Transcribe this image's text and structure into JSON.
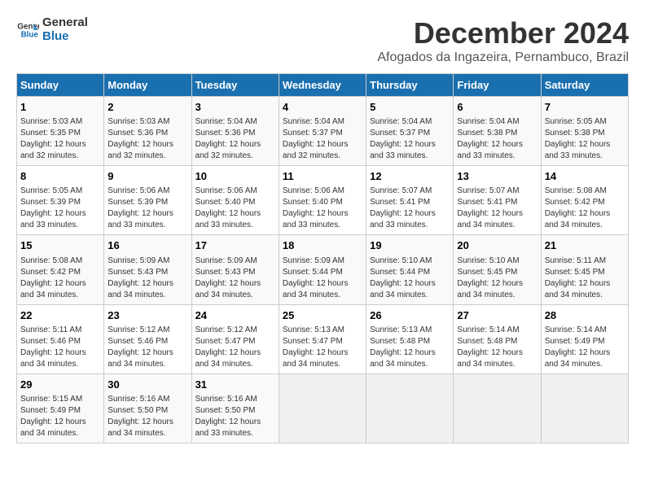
{
  "logo": {
    "line1": "General",
    "line2": "Blue"
  },
  "header": {
    "title": "December 2024",
    "subtitle": "Afogados da Ingazeira, Pernambuco, Brazil"
  },
  "days_of_week": [
    "Sunday",
    "Monday",
    "Tuesday",
    "Wednesday",
    "Thursday",
    "Friday",
    "Saturday"
  ],
  "weeks": [
    [
      {
        "day": "1",
        "info": "Sunrise: 5:03 AM\nSunset: 5:35 PM\nDaylight: 12 hours\nand 32 minutes."
      },
      {
        "day": "2",
        "info": "Sunrise: 5:03 AM\nSunset: 5:36 PM\nDaylight: 12 hours\nand 32 minutes."
      },
      {
        "day": "3",
        "info": "Sunrise: 5:04 AM\nSunset: 5:36 PM\nDaylight: 12 hours\nand 32 minutes."
      },
      {
        "day": "4",
        "info": "Sunrise: 5:04 AM\nSunset: 5:37 PM\nDaylight: 12 hours\nand 32 minutes."
      },
      {
        "day": "5",
        "info": "Sunrise: 5:04 AM\nSunset: 5:37 PM\nDaylight: 12 hours\nand 33 minutes."
      },
      {
        "day": "6",
        "info": "Sunrise: 5:04 AM\nSunset: 5:38 PM\nDaylight: 12 hours\nand 33 minutes."
      },
      {
        "day": "7",
        "info": "Sunrise: 5:05 AM\nSunset: 5:38 PM\nDaylight: 12 hours\nand 33 minutes."
      }
    ],
    [
      {
        "day": "8",
        "info": "Sunrise: 5:05 AM\nSunset: 5:39 PM\nDaylight: 12 hours\nand 33 minutes."
      },
      {
        "day": "9",
        "info": "Sunrise: 5:06 AM\nSunset: 5:39 PM\nDaylight: 12 hours\nand 33 minutes."
      },
      {
        "day": "10",
        "info": "Sunrise: 5:06 AM\nSunset: 5:40 PM\nDaylight: 12 hours\nand 33 minutes."
      },
      {
        "day": "11",
        "info": "Sunrise: 5:06 AM\nSunset: 5:40 PM\nDaylight: 12 hours\nand 33 minutes."
      },
      {
        "day": "12",
        "info": "Sunrise: 5:07 AM\nSunset: 5:41 PM\nDaylight: 12 hours\nand 33 minutes."
      },
      {
        "day": "13",
        "info": "Sunrise: 5:07 AM\nSunset: 5:41 PM\nDaylight: 12 hours\nand 34 minutes."
      },
      {
        "day": "14",
        "info": "Sunrise: 5:08 AM\nSunset: 5:42 PM\nDaylight: 12 hours\nand 34 minutes."
      }
    ],
    [
      {
        "day": "15",
        "info": "Sunrise: 5:08 AM\nSunset: 5:42 PM\nDaylight: 12 hours\nand 34 minutes."
      },
      {
        "day": "16",
        "info": "Sunrise: 5:09 AM\nSunset: 5:43 PM\nDaylight: 12 hours\nand 34 minutes."
      },
      {
        "day": "17",
        "info": "Sunrise: 5:09 AM\nSunset: 5:43 PM\nDaylight: 12 hours\nand 34 minutes."
      },
      {
        "day": "18",
        "info": "Sunrise: 5:09 AM\nSunset: 5:44 PM\nDaylight: 12 hours\nand 34 minutes."
      },
      {
        "day": "19",
        "info": "Sunrise: 5:10 AM\nSunset: 5:44 PM\nDaylight: 12 hours\nand 34 minutes."
      },
      {
        "day": "20",
        "info": "Sunrise: 5:10 AM\nSunset: 5:45 PM\nDaylight: 12 hours\nand 34 minutes."
      },
      {
        "day": "21",
        "info": "Sunrise: 5:11 AM\nSunset: 5:45 PM\nDaylight: 12 hours\nand 34 minutes."
      }
    ],
    [
      {
        "day": "22",
        "info": "Sunrise: 5:11 AM\nSunset: 5:46 PM\nDaylight: 12 hours\nand 34 minutes."
      },
      {
        "day": "23",
        "info": "Sunrise: 5:12 AM\nSunset: 5:46 PM\nDaylight: 12 hours\nand 34 minutes."
      },
      {
        "day": "24",
        "info": "Sunrise: 5:12 AM\nSunset: 5:47 PM\nDaylight: 12 hours\nand 34 minutes."
      },
      {
        "day": "25",
        "info": "Sunrise: 5:13 AM\nSunset: 5:47 PM\nDaylight: 12 hours\nand 34 minutes."
      },
      {
        "day": "26",
        "info": "Sunrise: 5:13 AM\nSunset: 5:48 PM\nDaylight: 12 hours\nand 34 minutes."
      },
      {
        "day": "27",
        "info": "Sunrise: 5:14 AM\nSunset: 5:48 PM\nDaylight: 12 hours\nand 34 minutes."
      },
      {
        "day": "28",
        "info": "Sunrise: 5:14 AM\nSunset: 5:49 PM\nDaylight: 12 hours\nand 34 minutes."
      }
    ],
    [
      {
        "day": "29",
        "info": "Sunrise: 5:15 AM\nSunset: 5:49 PM\nDaylight: 12 hours\nand 34 minutes."
      },
      {
        "day": "30",
        "info": "Sunrise: 5:16 AM\nSunset: 5:50 PM\nDaylight: 12 hours\nand 34 minutes."
      },
      {
        "day": "31",
        "info": "Sunrise: 5:16 AM\nSunset: 5:50 PM\nDaylight: 12 hours\nand 33 minutes."
      },
      {
        "day": "",
        "info": ""
      },
      {
        "day": "",
        "info": ""
      },
      {
        "day": "",
        "info": ""
      },
      {
        "day": "",
        "info": ""
      }
    ]
  ]
}
